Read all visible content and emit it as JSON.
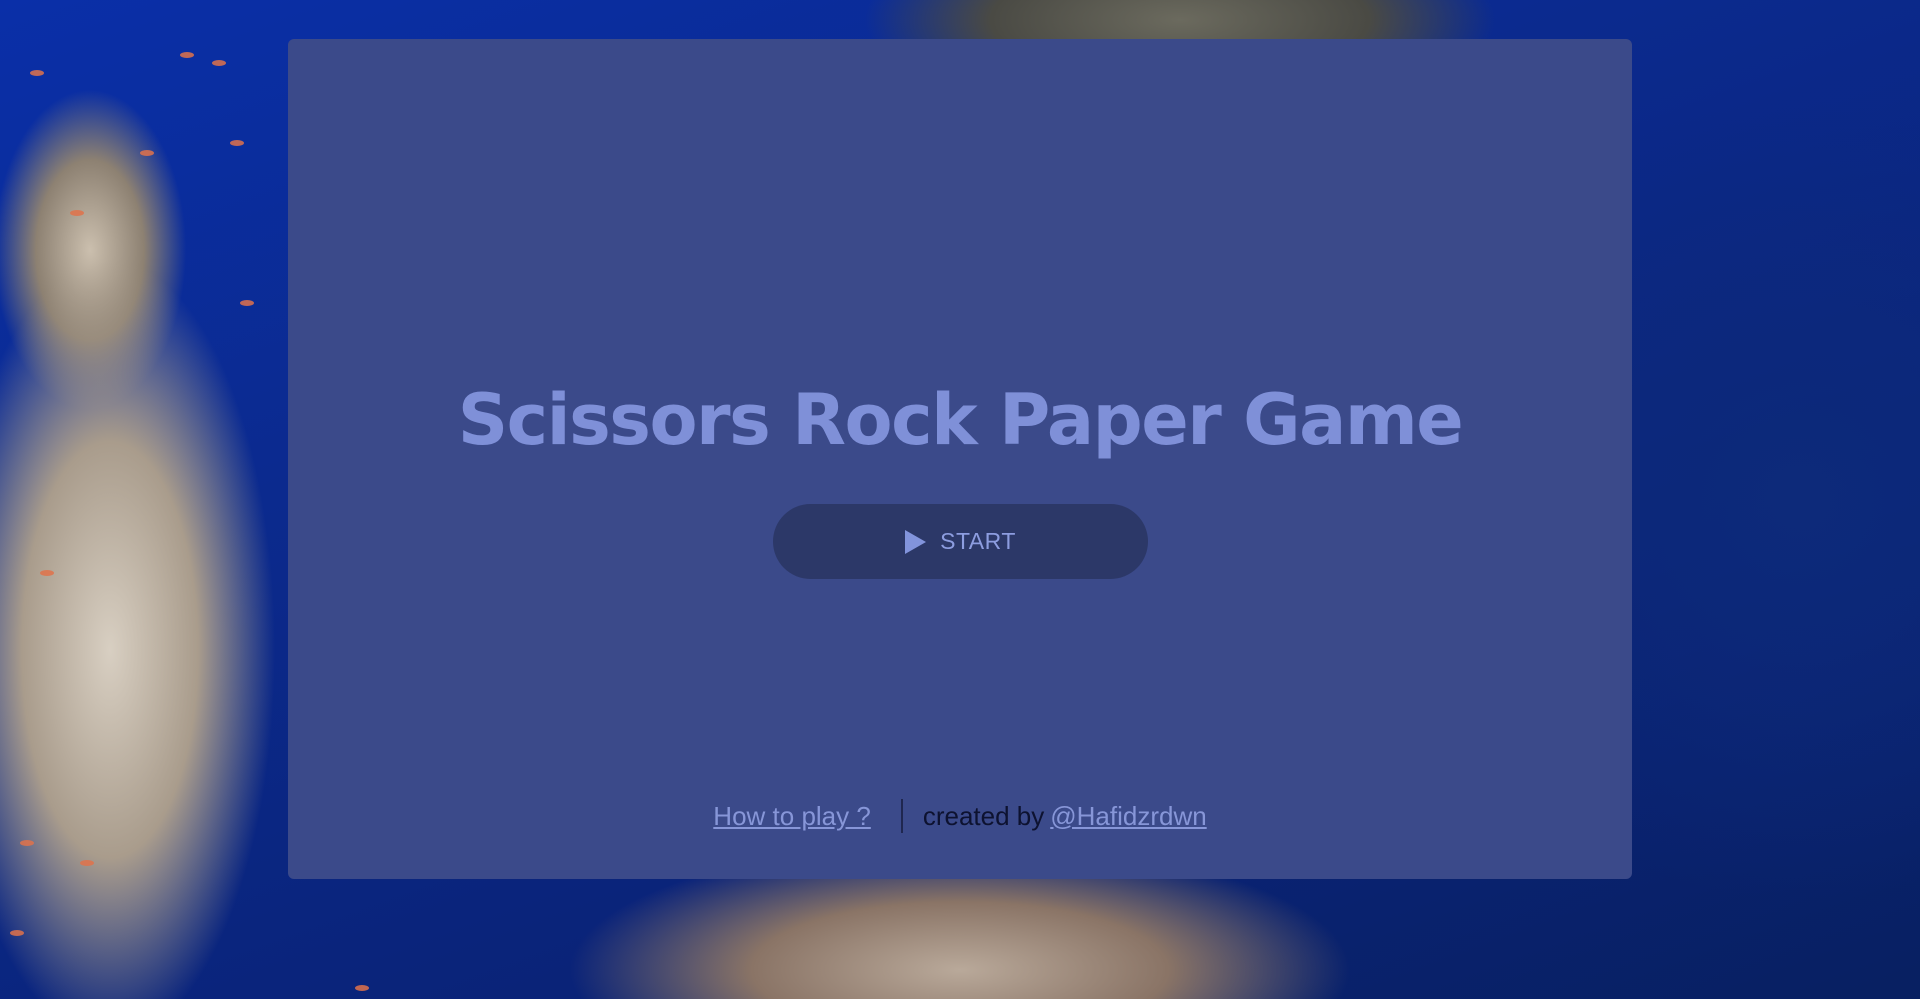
{
  "game": {
    "title": "Scissors Rock Paper Game",
    "start_button": {
      "label": "START",
      "icon": "play-icon"
    },
    "footer": {
      "how_to_play_label": "How to play ?",
      "created_by_label": "created by",
      "author_link_label": "@Hafidzrdwn"
    }
  },
  "colors": {
    "panel": "#3b4a8a",
    "title": "#7f90d8",
    "button_bg": "#2c3868",
    "link": "#8796d8"
  }
}
